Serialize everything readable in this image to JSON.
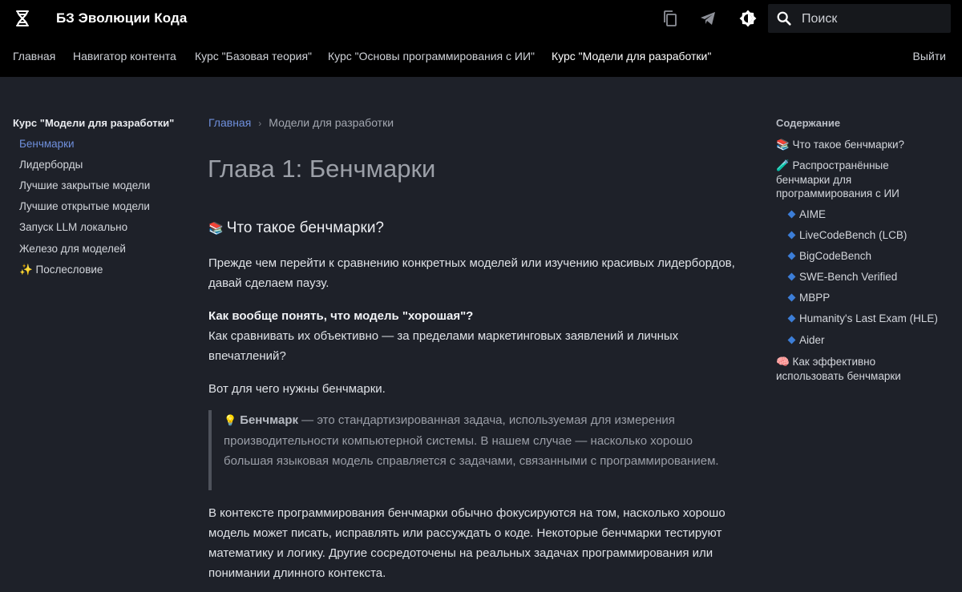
{
  "header": {
    "site_title": "БЗ Эволюции Кода",
    "search_placeholder": "Поиск",
    "tabs": [
      "Главная",
      "Навигатор контента",
      "Курс \"Базовая теория\"",
      "Курс \"Основы программирования с ИИ\"",
      "Курс \"Модели для разработки\""
    ],
    "active_tab": 4,
    "logout": "Выйти"
  },
  "sidebar": {
    "title": "Курс \"Модели для разработки\"",
    "items": [
      "Бенчмарки",
      "Лидерборды",
      "Лучшие закрытые модели",
      "Лучшие открытые модели",
      "Запуск LLM локально",
      "Железо для моделей",
      "✨ Послесловие"
    ],
    "active_index": 0
  },
  "main": {
    "breadcrumb": {
      "home": "Главная",
      "separator": "›",
      "current": "Модели для разработки"
    },
    "title": "Глава 1: Бенчмарки",
    "section_emoji": "📚",
    "section_title": "Что такое бенчмарки?",
    "p1": "Прежде чем перейти к сравнению конкретных моделей или изучению красивых лидербордов, давай сделаем паузу.",
    "p2_bold": "Как вообще понять, что модель \"хорошая\"?",
    "p2_text": "Как сравнивать их объективно — за пределами маркетинговых заявлений и личных впечатлений?",
    "p3": "Вот для чего нужны бенчмарки.",
    "quote_emoji": "💡",
    "quote_bold": "Бенчмарк",
    "quote_text": " — это стандартизированная задача, используемая для измерения производительности компьютерной системы. В нашем случае — насколько хорошо большая языковая модель справляется с задачами, связанными с программированием.",
    "p4": "В контексте программирования бенчмарки обычно фокусируются на том, насколько хорошо модель может писать, исправлять или рассуждать о коде. Некоторые бенчмарки тестируют математику и логику. Другие сосредоточены на реальных задачах программирования или понимании длинного контекста."
  },
  "toc": {
    "title": "Содержание",
    "item1": "📚 Что такое бенчмарки?",
    "item2": "🧪 Распространённые бенчмарки для программирования с ИИ",
    "subitems": [
      "AIME",
      "LiveCodeBench (LCB)",
      "BigCodeBench",
      "SWE-Bench Verified",
      "MBPP",
      "Humanity's Last Exam (HLE)",
      "Aider"
    ],
    "item3": "🧠 Как эффективно использовать бенчмарки"
  },
  "icons": {
    "logo": "hourglass-dna-icon",
    "copy": "copy-icon",
    "telegram": "telegram-icon",
    "theme": "theme-toggle-icon",
    "search": "search-icon",
    "toc_diamond": "blue-diamond-icon"
  },
  "colors": {
    "background": "#1e2129",
    "header": "#000000",
    "link": "#6f8fdc",
    "diamond": "#3c7ed8"
  }
}
